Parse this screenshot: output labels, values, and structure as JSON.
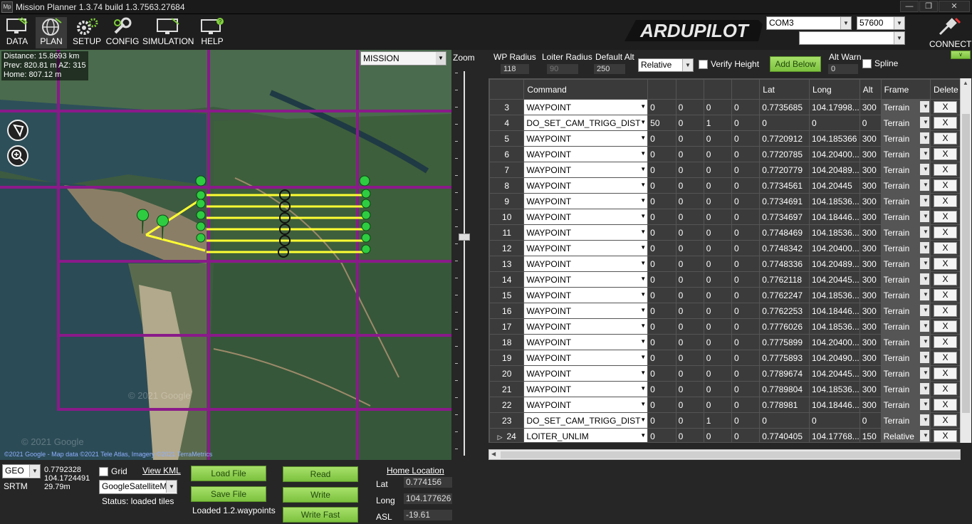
{
  "window": {
    "title": "Mission Planner 1.3.74 build 1.3.7563.27684",
    "icon": "Mp"
  },
  "toolbar": {
    "items": [
      {
        "label": "DATA",
        "icon": "monitor-icon"
      },
      {
        "label": "PLAN",
        "icon": "globe-icon"
      },
      {
        "label": "SETUP",
        "icon": "gears-icon"
      },
      {
        "label": "CONFIG",
        "icon": "wrench-icon"
      },
      {
        "label": "SIMULATION",
        "icon": "simulation-monitor-icon"
      },
      {
        "label": "HELP",
        "icon": "help-monitor-icon"
      }
    ],
    "logo": "ARDUPILOT",
    "port": "COM3",
    "baud": "57600",
    "connect": "CONNECT"
  },
  "map": {
    "info": {
      "distance": "Distance: 15.8693 km",
      "prev": "Prev: 820.81 m AZ: 315",
      "home": "Home: 807.12 m"
    },
    "mode": "MISSION",
    "zoom_label": "Zoom",
    "copyright": "©2021 Google - Map data ©2021 Tele Atlas, Imagery ©2021 TerraMetrics",
    "watermark": "© 2021 Google"
  },
  "params": {
    "wp_radius_label": "WP Radius",
    "wp_radius": "118",
    "loiter_radius_label": "Loiter Radius",
    "loiter_radius": "90",
    "default_alt_label": "Default Alt",
    "default_alt": "250",
    "alt_mode": "Relative",
    "verify_height": "Verify Height",
    "add_below": "Add Below",
    "alt_warn_label": "Alt Warn",
    "alt_warn": "0",
    "spline": "Spline"
  },
  "table": {
    "headers": [
      "",
      "Command",
      "",
      "",
      "",
      "",
      "Lat",
      "Long",
      "Alt",
      "Frame",
      "Delete"
    ],
    "rows": [
      {
        "n": "3",
        "cmd": "WAYPOINT",
        "p1": "0",
        "p2": "0",
        "p3": "0",
        "p4": "0",
        "lat": "0.7735685",
        "lng": "104.17998...",
        "alt": "300",
        "frame": "Terrain"
      },
      {
        "n": "4",
        "cmd": "DO_SET_CAM_TRIGG_DIST",
        "p1": "50",
        "p2": "0",
        "p3": "1",
        "p4": "0",
        "lat": "0",
        "lng": "0",
        "alt": "0",
        "frame": "Terrain"
      },
      {
        "n": "5",
        "cmd": "WAYPOINT",
        "p1": "0",
        "p2": "0",
        "p3": "0",
        "p4": "0",
        "lat": "0.7720912",
        "lng": "104.185366",
        "alt": "300",
        "frame": "Terrain"
      },
      {
        "n": "6",
        "cmd": "WAYPOINT",
        "p1": "0",
        "p2": "0",
        "p3": "0",
        "p4": "0",
        "lat": "0.7720785",
        "lng": "104.20400...",
        "alt": "300",
        "frame": "Terrain"
      },
      {
        "n": "7",
        "cmd": "WAYPOINT",
        "p1": "0",
        "p2": "0",
        "p3": "0",
        "p4": "0",
        "lat": "0.7720779",
        "lng": "104.20489...",
        "alt": "300",
        "frame": "Terrain"
      },
      {
        "n": "8",
        "cmd": "WAYPOINT",
        "p1": "0",
        "p2": "0",
        "p3": "0",
        "p4": "0",
        "lat": "0.7734561",
        "lng": "104.20445",
        "alt": "300",
        "frame": "Terrain"
      },
      {
        "n": "9",
        "cmd": "WAYPOINT",
        "p1": "0",
        "p2": "0",
        "p3": "0",
        "p4": "0",
        "lat": "0.7734691",
        "lng": "104.18536...",
        "alt": "300",
        "frame": "Terrain"
      },
      {
        "n": "10",
        "cmd": "WAYPOINT",
        "p1": "0",
        "p2": "0",
        "p3": "0",
        "p4": "0",
        "lat": "0.7734697",
        "lng": "104.18446...",
        "alt": "300",
        "frame": "Terrain"
      },
      {
        "n": "11",
        "cmd": "WAYPOINT",
        "p1": "0",
        "p2": "0",
        "p3": "0",
        "p4": "0",
        "lat": "0.7748469",
        "lng": "104.18536...",
        "alt": "300",
        "frame": "Terrain"
      },
      {
        "n": "12",
        "cmd": "WAYPOINT",
        "p1": "0",
        "p2": "0",
        "p3": "0",
        "p4": "0",
        "lat": "0.7748342",
        "lng": "104.20400...",
        "alt": "300",
        "frame": "Terrain"
      },
      {
        "n": "13",
        "cmd": "WAYPOINT",
        "p1": "0",
        "p2": "0",
        "p3": "0",
        "p4": "0",
        "lat": "0.7748336",
        "lng": "104.20489...",
        "alt": "300",
        "frame": "Terrain"
      },
      {
        "n": "14",
        "cmd": "WAYPOINT",
        "p1": "0",
        "p2": "0",
        "p3": "0",
        "p4": "0",
        "lat": "0.7762118",
        "lng": "104.20445...",
        "alt": "300",
        "frame": "Terrain"
      },
      {
        "n": "15",
        "cmd": "WAYPOINT",
        "p1": "0",
        "p2": "0",
        "p3": "0",
        "p4": "0",
        "lat": "0.7762247",
        "lng": "104.18536...",
        "alt": "300",
        "frame": "Terrain"
      },
      {
        "n": "16",
        "cmd": "WAYPOINT",
        "p1": "0",
        "p2": "0",
        "p3": "0",
        "p4": "0",
        "lat": "0.7762253",
        "lng": "104.18446...",
        "alt": "300",
        "frame": "Terrain"
      },
      {
        "n": "17",
        "cmd": "WAYPOINT",
        "p1": "0",
        "p2": "0",
        "p3": "0",
        "p4": "0",
        "lat": "0.7776026",
        "lng": "104.18536...",
        "alt": "300",
        "frame": "Terrain"
      },
      {
        "n": "18",
        "cmd": "WAYPOINT",
        "p1": "0",
        "p2": "0",
        "p3": "0",
        "p4": "0",
        "lat": "0.7775899",
        "lng": "104.20400...",
        "alt": "300",
        "frame": "Terrain"
      },
      {
        "n": "19",
        "cmd": "WAYPOINT",
        "p1": "0",
        "p2": "0",
        "p3": "0",
        "p4": "0",
        "lat": "0.7775893",
        "lng": "104.20490...",
        "alt": "300",
        "frame": "Terrain"
      },
      {
        "n": "20",
        "cmd": "WAYPOINT",
        "p1": "0",
        "p2": "0",
        "p3": "0",
        "p4": "0",
        "lat": "0.7789674",
        "lng": "104.20445...",
        "alt": "300",
        "frame": "Terrain"
      },
      {
        "n": "21",
        "cmd": "WAYPOINT",
        "p1": "0",
        "p2": "0",
        "p3": "0",
        "p4": "0",
        "lat": "0.7789804",
        "lng": "104.18536...",
        "alt": "300",
        "frame": "Terrain"
      },
      {
        "n": "22",
        "cmd": "WAYPOINT",
        "p1": "0",
        "p2": "0",
        "p3": "0",
        "p4": "0",
        "lat": "0.778981",
        "lng": "104.18446...",
        "alt": "300",
        "frame": "Terrain"
      },
      {
        "n": "23",
        "cmd": "DO_SET_CAM_TRIGG_DIST",
        "p1": "0",
        "p2": "0",
        "p3": "1",
        "p4": "0",
        "lat": "0",
        "lng": "0",
        "alt": "0",
        "frame": "Terrain"
      },
      {
        "n": "24",
        "cmd": "LOITER_UNLIM",
        "p1": "0",
        "p2": "0",
        "p3": "0",
        "p4": "0",
        "lat": "0.7740405",
        "lng": "104.17768...",
        "alt": "150",
        "frame": "Relative",
        "current": true
      }
    ],
    "delete_label": "X"
  },
  "bottom": {
    "coord_mode": "GEO",
    "lat": "0.7792328",
    "lng": "104.1724491",
    "alt": "29.79m",
    "srtm": "SRTM",
    "grid": "Grid",
    "view_kml": "View KML",
    "map_type": "GoogleSatelliteMap",
    "status": "Status: loaded tiles",
    "load_file": "Load File",
    "save_file": "Save File",
    "loaded": "Loaded 1.2.waypoints",
    "read": "Read",
    "write": "Write",
    "write_fast": "Write Fast",
    "home_location": "Home Location",
    "home_lat_label": "Lat",
    "home_lat": "0.774156",
    "home_long_label": "Long",
    "home_long": "104.177626",
    "home_asl_label": "ASL",
    "home_asl": "-19.61"
  }
}
